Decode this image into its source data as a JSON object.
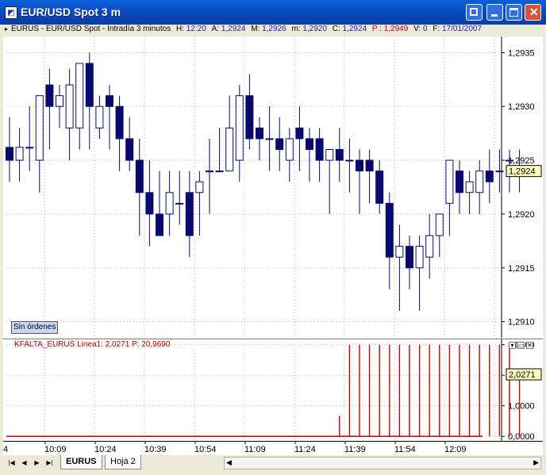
{
  "window": {
    "title": "EUR/USD Spot 3 m",
    "app_icon": "chart-app-icon",
    "buttons": {
      "restore_icon": "restore-icon",
      "minimize_icon": "minimize-icon",
      "maximize_icon": "maximize-icon",
      "close_icon": "close-icon"
    }
  },
  "infobar": {
    "symbol": "EURUS - EUR/USD Spot - Intradía 3 minutos",
    "h_label": "H:",
    "h_value": "12:20",
    "a_label": "A:",
    "a_value": "1,2924",
    "m_label": "M:",
    "m_value": "1,2926",
    "mn_label": "m:",
    "mn_value": "1,2920",
    "c_label": "C:",
    "c_value": "1,2924",
    "p_label": "P :",
    "p_value": "1,2949",
    "v_label": "V:",
    "v_value": "0",
    "f_label": "F:",
    "f_value": "17/01/2007",
    "colors": {
      "label": "#000000",
      "value": "#1a1aa8",
      "p": "#cc0000"
    }
  },
  "main_chart": {
    "orders_badge": "Sin órdenes",
    "current_price_label": "1,2924",
    "price_ticks": [
      "1,2935",
      "1,2930",
      "1,2925",
      "1,2920",
      "1,2915",
      "1,2910"
    ]
  },
  "indicator": {
    "title": "KFALTA_EURUS  Linea1: 2,0271  P: 20,9690",
    "current_label": "2,0271",
    "ticks": [
      "3,0000",
      "2,0000",
      "1,0000",
      "0,0000"
    ]
  },
  "time_axis": {
    "ticks": [
      "4",
      "10:09",
      "10:24",
      "10:39",
      "10:54",
      "11:09",
      "11:24",
      "11:39",
      "11:54",
      "12:09"
    ]
  },
  "sheets": {
    "nav": [
      "|◀",
      "◀",
      "▶",
      "▶|"
    ],
    "tabs": [
      "EURUS",
      "Hoja 2"
    ]
  },
  "chart_data": [
    {
      "type": "candlestick",
      "title": "EUR/USD Spot 3 m",
      "ylim": [
        1.29085,
        1.29365
      ],
      "yticks": [
        1.2935,
        1.293,
        1.2925,
        1.292,
        1.2915,
        1.291
      ],
      "colors": {
        "up": "#ffffff",
        "down": "#0a0a6e",
        "wick": "#0a0a6e"
      },
      "candles": [
        {
          "o": 1.29262,
          "h": 1.2929,
          "l": 1.2923,
          "c": 1.2925
        },
        {
          "o": 1.2925,
          "h": 1.2928,
          "l": 1.2923,
          "c": 1.29262
        },
        {
          "o": 1.29262,
          "h": 1.293,
          "l": 1.2924,
          "c": 1.29262
        },
        {
          "o": 1.2925,
          "h": 1.2931,
          "l": 1.2922,
          "c": 1.2931
        },
        {
          "o": 1.2932,
          "h": 1.29335,
          "l": 1.2926,
          "c": 1.293
        },
        {
          "o": 1.293,
          "h": 1.2932,
          "l": 1.2928,
          "c": 1.2931
        },
        {
          "o": 1.2928,
          "h": 1.29335,
          "l": 1.2925,
          "c": 1.2932
        },
        {
          "o": 1.2928,
          "h": 1.2934,
          "l": 1.2926,
          "c": 1.2934
        },
        {
          "o": 1.2934,
          "h": 1.2935,
          "l": 1.2926,
          "c": 1.293
        },
        {
          "o": 1.2928,
          "h": 1.2931,
          "l": 1.2927,
          "c": 1.293
        },
        {
          "o": 1.2931,
          "h": 1.2932,
          "l": 1.2926,
          "c": 1.293
        },
        {
          "o": 1.293,
          "h": 1.2931,
          "l": 1.2924,
          "c": 1.2927
        },
        {
          "o": 1.2927,
          "h": 1.2929,
          "l": 1.2924,
          "c": 1.2925
        },
        {
          "o": 1.2925,
          "h": 1.2927,
          "l": 1.2918,
          "c": 1.2922
        },
        {
          "o": 1.2922,
          "h": 1.2925,
          "l": 1.2917,
          "c": 1.292
        },
        {
          "o": 1.292,
          "h": 1.2924,
          "l": 1.2918,
          "c": 1.2918
        },
        {
          "o": 1.292,
          "h": 1.2924,
          "l": 1.2918,
          "c": 1.2922
        },
        {
          "o": 1.2921,
          "h": 1.2924,
          "l": 1.2919,
          "c": 1.2921
        },
        {
          "o": 1.2922,
          "h": 1.2924,
          "l": 1.2916,
          "c": 1.2918
        },
        {
          "o": 1.2922,
          "h": 1.2924,
          "l": 1.2918,
          "c": 1.2923
        },
        {
          "o": 1.2924,
          "h": 1.2927,
          "l": 1.292,
          "c": 1.2924
        },
        {
          "o": 1.2924,
          "h": 1.2928,
          "l": 1.2924,
          "c": 1.2924
        },
        {
          "o": 1.2924,
          "h": 1.2931,
          "l": 1.2924,
          "c": 1.2928
        },
        {
          "o": 1.2925,
          "h": 1.2932,
          "l": 1.2923,
          "c": 1.2931
        },
        {
          "o": 1.2931,
          "h": 1.2933,
          "l": 1.2926,
          "c": 1.2927
        },
        {
          "o": 1.2928,
          "h": 1.2929,
          "l": 1.2925,
          "c": 1.2927
        },
        {
          "o": 1.2927,
          "h": 1.293,
          "l": 1.2924,
          "c": 1.2927
        },
        {
          "o": 1.2927,
          "h": 1.2929,
          "l": 1.2924,
          "c": 1.2926
        },
        {
          "o": 1.2925,
          "h": 1.2928,
          "l": 1.2923,
          "c": 1.2927
        },
        {
          "o": 1.2928,
          "h": 1.293,
          "l": 1.2924,
          "c": 1.2927
        },
        {
          "o": 1.2927,
          "h": 1.2928,
          "l": 1.2923,
          "c": 1.2926
        },
        {
          "o": 1.2927,
          "h": 1.2928,
          "l": 1.2923,
          "c": 1.2925
        },
        {
          "o": 1.2925,
          "h": 1.2926,
          "l": 1.292,
          "c": 1.2926
        },
        {
          "o": 1.2926,
          "h": 1.2928,
          "l": 1.2923,
          "c": 1.2925
        },
        {
          "o": 1.2925,
          "h": 1.2927,
          "l": 1.2922,
          "c": 1.2925
        },
        {
          "o": 1.2925,
          "h": 1.2926,
          "l": 1.292,
          "c": 1.2924
        },
        {
          "o": 1.2925,
          "h": 1.2926,
          "l": 1.2921,
          "c": 1.2924
        },
        {
          "o": 1.2924,
          "h": 1.2925,
          "l": 1.292,
          "c": 1.2921
        },
        {
          "o": 1.2921,
          "h": 1.2922,
          "l": 1.2913,
          "c": 1.2916
        },
        {
          "o": 1.2916,
          "h": 1.2919,
          "l": 1.2911,
          "c": 1.2917
        },
        {
          "o": 1.2917,
          "h": 1.2918,
          "l": 1.2913,
          "c": 1.2915
        },
        {
          "o": 1.2915,
          "h": 1.2918,
          "l": 1.2911,
          "c": 1.2917
        },
        {
          "o": 1.2916,
          "h": 1.292,
          "l": 1.2914,
          "c": 1.2918
        },
        {
          "o": 1.2918,
          "h": 1.292,
          "l": 1.2916,
          "c": 1.292
        },
        {
          "o": 1.2921,
          "h": 1.2925,
          "l": 1.2918,
          "c": 1.2925
        },
        {
          "o": 1.2924,
          "h": 1.2925,
          "l": 1.292,
          "c": 1.2922
        },
        {
          "o": 1.2922,
          "h": 1.2924,
          "l": 1.292,
          "c": 1.2923
        },
        {
          "o": 1.2922,
          "h": 1.2925,
          "l": 1.292,
          "c": 1.2924
        },
        {
          "o": 1.2924,
          "h": 1.2926,
          "l": 1.2921,
          "c": 1.2923
        },
        {
          "o": 1.2924,
          "h": 1.2926,
          "l": 1.2922,
          "c": 1.2924
        },
        {
          "o": 1.2925,
          "h": 1.2926,
          "l": 1.2922,
          "c": 1.2925
        },
        {
          "o": 1.2924,
          "h": 1.2926,
          "l": 1.2922,
          "c": 1.2924
        }
      ]
    },
    {
      "type": "bar",
      "title": "KFALTA_EURUS  Linea1: 2,0271  P: 20,9690",
      "ylim": [
        -0.15,
        3.2
      ],
      "yticks": [
        3.0,
        2.0,
        1.0,
        0.0
      ],
      "color": "#cc0000",
      "values": [
        0,
        0,
        0,
        0,
        0,
        0,
        0,
        0,
        0,
        0,
        0,
        0,
        0,
        0,
        0,
        0,
        0,
        0,
        0,
        0,
        0,
        0,
        0,
        0,
        0,
        0,
        0,
        0,
        0,
        0,
        0,
        0,
        0,
        0.67,
        3,
        3,
        3,
        3,
        3,
        3,
        3,
        3,
        3,
        3,
        3,
        3,
        3,
        3,
        3,
        3,
        3,
        2.03
      ]
    }
  ]
}
